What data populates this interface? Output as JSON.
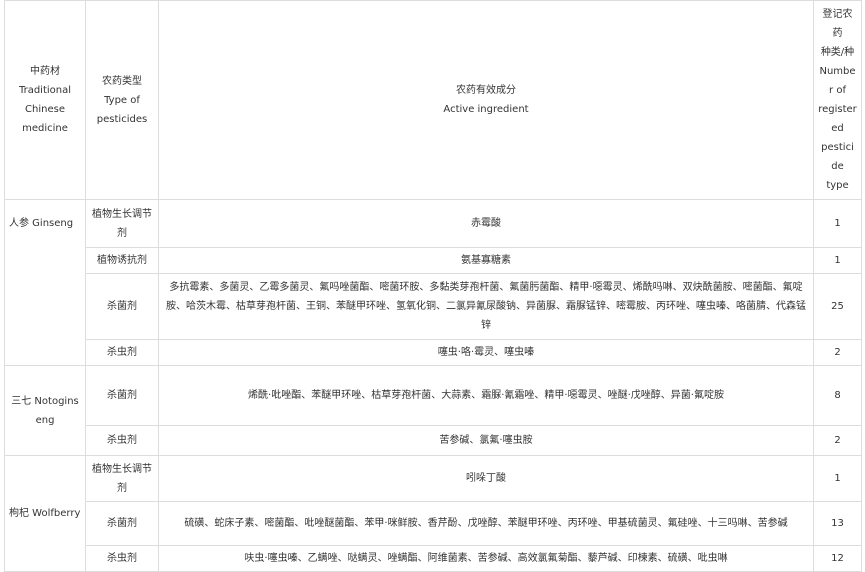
{
  "header": {
    "col1": [
      "中药材",
      "Traditional",
      "Chinese",
      "medicine"
    ],
    "col2": [
      "农药类型",
      "Type of",
      "pesticides"
    ],
    "col3": [
      "农药有效成分",
      "Active ingredient"
    ],
    "col4": [
      "登记农药",
      "种类/种",
      "Number of",
      "registered",
      "pesticide",
      "type"
    ]
  },
  "rows": [
    {
      "herb": "人参 Ginseng",
      "type": "植物生长调节剂",
      "ingredient": "赤霉酸",
      "count": "1"
    },
    {
      "type": "植物诱抗剂",
      "ingredient": "氨基寡糖素",
      "count": "1"
    },
    {
      "type": "杀菌剂",
      "ingredient": "多抗霉素、多菌灵、乙霉多菌灵、氟吗唑菌酯、嘧菌环胺、多黏类芽孢杆菌、氟菌肟菌酯、精甲·噁霉灵、烯酰吗啉、双炔酰菌胺、嘧菌酯、氟啶胺、哈茨木霉、枯草芽孢杆菌、王铜、苯醚甲环唑、氢氧化铜、二氯异氰尿酸钠、异菌脲、霜脲锰锌、嘧霉胺、丙环唑、噻虫嗪、咯菌腈、代森锰锌",
      "count": "25"
    },
    {
      "type": "杀虫剂",
      "ingredient": "噻虫·咯·霉灵、噻虫嗪",
      "count": "2"
    },
    {
      "herb": "三七 Notoginseng",
      "type": "杀菌剂",
      "ingredient": "烯酰·吡唑酯、苯醚甲环唑、枯草芽孢杆菌、大蒜素、霜脲·氰霜唑、精甲·噁霉灵、唑醚·戊唑醇、异菌·氟啶胺",
      "count": "8"
    },
    {
      "type": "杀虫剂",
      "ingredient": "苦参碱、氯氟·噻虫胺",
      "count": "2"
    },
    {
      "herb": "枸杞 Wolfberry",
      "type": "植物生长调节剂",
      "ingredient": "吲哚丁酸",
      "count": "1"
    },
    {
      "type": "杀菌剂",
      "ingredient": "硫磺、蛇床子素、嘧菌酯、吡唑醚菌酯、苯甲·咪鲜胺、香芹酚、戊唑醇、苯醚甲环唑、丙环唑、甲基硫菌灵、氟硅唑、十三吗啉、苦参碱",
      "count": "13"
    },
    {
      "type": "杀虫剂",
      "ingredient": "呋虫·噻虫嗪、乙螨唑、哒螨灵、唑螨酯、阿维菌素、苦参碱、高效氯氟菊酯、藜芦碱、印楝素、硫磺、吡虫啉",
      "count": "12"
    }
  ]
}
